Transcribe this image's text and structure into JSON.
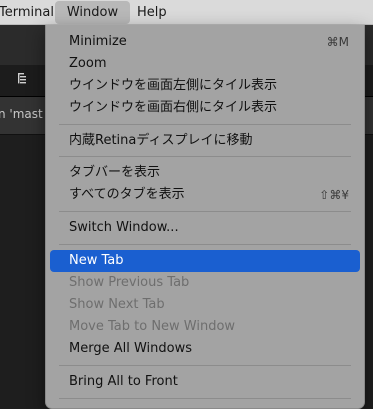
{
  "menubar": {
    "app": "Terminal",
    "window": "Window",
    "help": "Help"
  },
  "background": {
    "toolbar_icon": "list-icon",
    "tab_text": "n 'mast"
  },
  "menu": {
    "highlight_color": "#1a5fd0",
    "items": [
      {
        "label": "Minimize",
        "shortcut": "⌘M",
        "enabled": true
      },
      {
        "label": "Zoom",
        "shortcut": "",
        "enabled": true
      },
      {
        "label": "ウインドウを画面左側にタイル表示",
        "shortcut": "",
        "enabled": true
      },
      {
        "label": "ウインドウを画面右側にタイル表示",
        "shortcut": "",
        "enabled": true
      },
      {
        "label": "内蔵Retinaディスプレイに移動",
        "shortcut": "",
        "enabled": true
      },
      {
        "label": "タブバーを表示",
        "shortcut": "",
        "enabled": true
      },
      {
        "label": "すべてのタブを表示",
        "shortcut": "⇧⌘¥",
        "enabled": true
      },
      {
        "label": "Switch Window...",
        "shortcut": "",
        "enabled": true
      },
      {
        "label": "New Tab",
        "shortcut": "",
        "enabled": true,
        "highlighted": true
      },
      {
        "label": "Show Previous Tab",
        "shortcut": "",
        "enabled": false
      },
      {
        "label": "Show Next Tab",
        "shortcut": "",
        "enabled": false
      },
      {
        "label": "Move Tab to New Window",
        "shortcut": "",
        "enabled": false
      },
      {
        "label": "Merge All Windows",
        "shortcut": "",
        "enabled": true
      },
      {
        "label": "Bring All to Front",
        "shortcut": "",
        "enabled": true
      }
    ]
  }
}
